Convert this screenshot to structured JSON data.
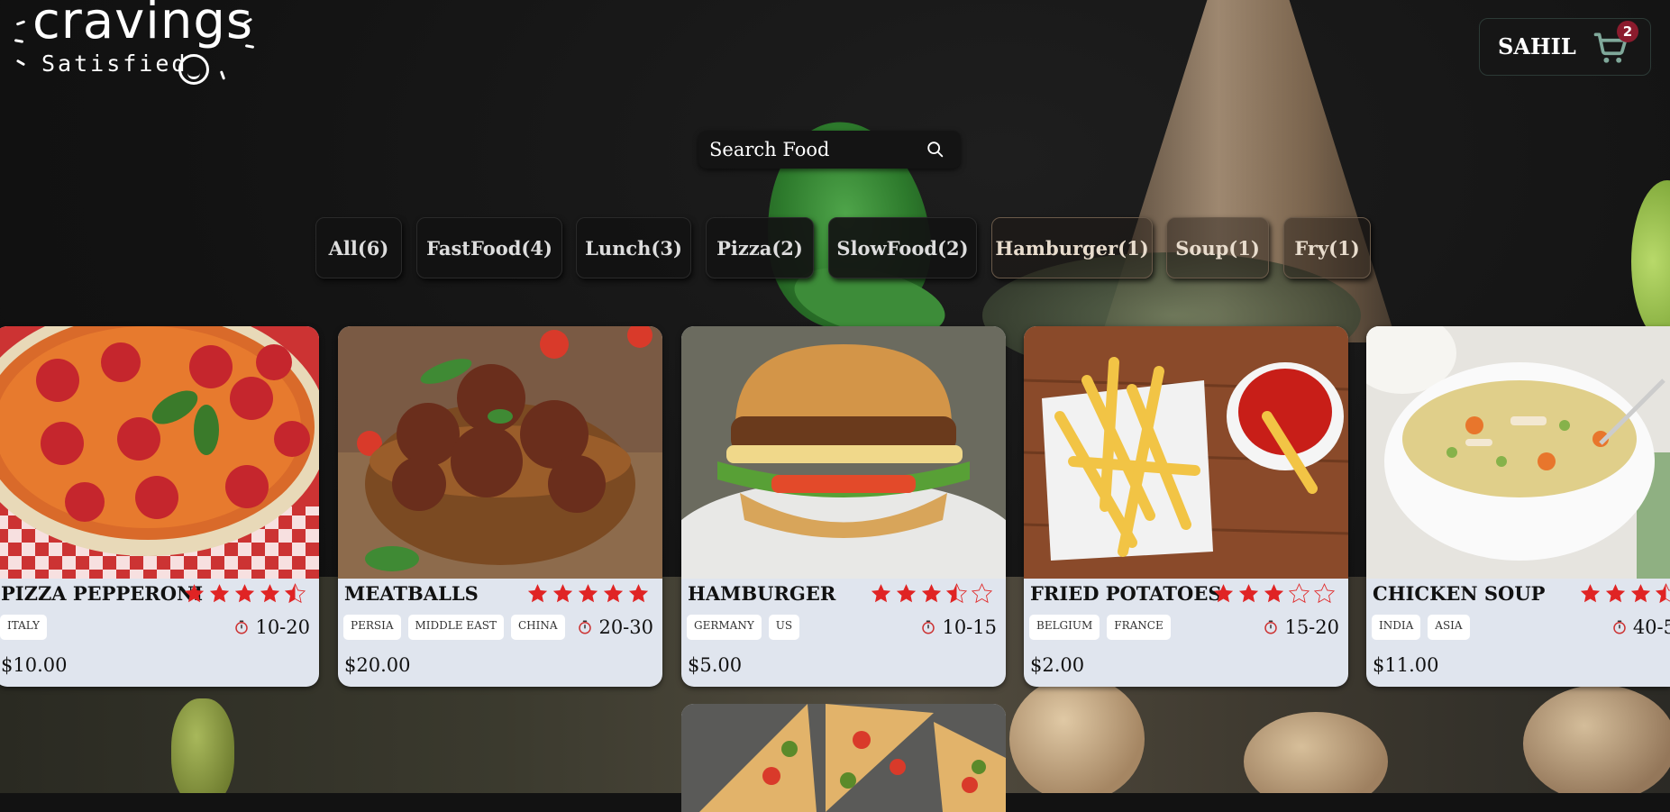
{
  "header": {
    "logo_title": "cravings",
    "logo_subtitle": "Satisfied",
    "user_name": "SAHIL",
    "cart_count": "2"
  },
  "search": {
    "placeholder": "Search Food"
  },
  "categories": [
    {
      "label": "All(6)"
    },
    {
      "label": "FastFood(4)"
    },
    {
      "label": "Lunch(3)"
    },
    {
      "label": "Pizza(2)"
    },
    {
      "label": "SlowFood(2)"
    },
    {
      "label": "Hamburger(1)"
    },
    {
      "label": "Soup(1)"
    },
    {
      "label": "Fry(1)"
    }
  ],
  "foods": [
    {
      "name": "PIZZA PEPPERONI",
      "rating": 4.5,
      "origins": [
        "ITALY"
      ],
      "time": "10-20",
      "price": "$10.00"
    },
    {
      "name": "MEATBALLS",
      "rating": 5,
      "origins": [
        "PERSIA",
        "MIDDLE EAST",
        "CHINA"
      ],
      "time": "20-30",
      "price": "$20.00"
    },
    {
      "name": "HAMBURGER",
      "rating": 3.5,
      "origins": [
        "GERMANY",
        "US"
      ],
      "time": "10-15",
      "price": "$5.00"
    },
    {
      "name": "FRIED POTATOES",
      "rating": 3,
      "origins": [
        "BELGIUM",
        "FRANCE"
      ],
      "time": "15-20",
      "price": "$2.00"
    },
    {
      "name": "CHICKEN SOUP",
      "rating": 3.5,
      "origins": [
        "INDIA",
        "ASIA"
      ],
      "time": "40-5",
      "price": "$11.00"
    }
  ],
  "colors": {
    "star": "#e02424",
    "card_bg": "#e0e5ee",
    "badge": "#8b1b2d",
    "cart_icon": "#7fa89a"
  }
}
